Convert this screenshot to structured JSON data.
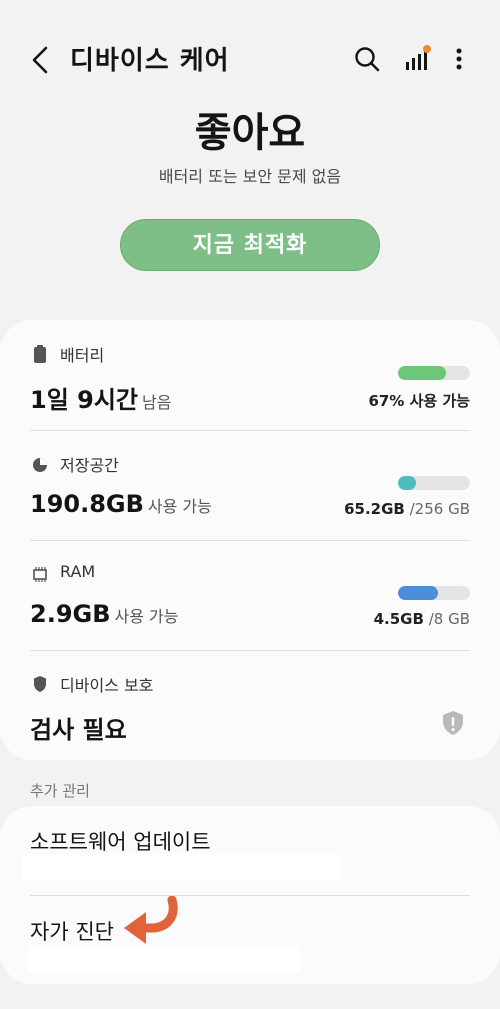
{
  "header": {
    "title": "디바이스 케어"
  },
  "icons": {
    "back": "back-arrow-icon",
    "search": "search-icon",
    "signal": "signal-bars-icon",
    "more": "more-vertical-icon"
  },
  "status": {
    "title": "좋아요",
    "subtitle": "배터리 또는 보안 문제 없음",
    "optimize_label": "지금 최적화"
  },
  "items": {
    "battery": {
      "label": "배터리",
      "value": "1일 9시간",
      "unit": "남음",
      "right": "67% 사용 가능",
      "level": 0.67,
      "color": "#6cc77a"
    },
    "storage": {
      "label": "저장공간",
      "value": "190.8GB",
      "unit": "사용 가능",
      "right_strong": "65.2GB",
      "right_light": "/256 GB",
      "level": 0.25,
      "color": "#4cbdbf"
    },
    "ram": {
      "label": "RAM",
      "value": "2.9GB",
      "unit": "사용 가능",
      "right_strong": "4.5GB",
      "right_light": "/8 GB",
      "level": 0.56,
      "color": "#4c8ed8"
    },
    "protection": {
      "label": "디바이스 보호",
      "value": "검사 필요"
    }
  },
  "extra": {
    "section_label": "추가 관리",
    "software_update": "소프트웨어 업데이트",
    "self_diagnosis": "자가 진단"
  },
  "colors": {
    "accent": "#7dbf87",
    "arrow": "#e0633a"
  }
}
